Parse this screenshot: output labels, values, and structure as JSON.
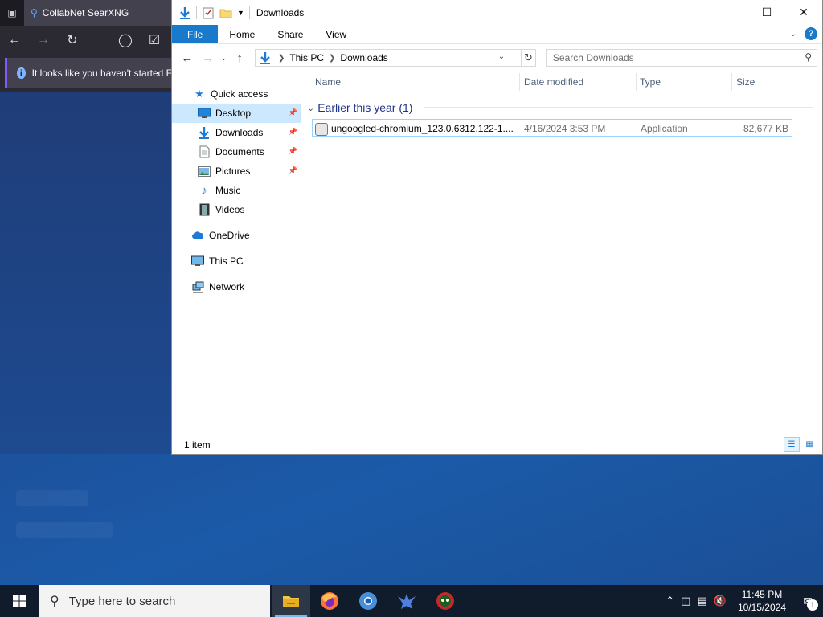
{
  "browser": {
    "tab_title": "CollabNet SearXNG",
    "banner_text": "It looks like you haven't started F"
  },
  "window": {
    "title": "Downloads",
    "ribbon_tabs": [
      "File",
      "Home",
      "Share",
      "View"
    ],
    "help": "?"
  },
  "address": {
    "crumbs": [
      "This PC",
      "Downloads"
    ],
    "search_placeholder": "Search Downloads"
  },
  "nav": {
    "quick_access": "Quick access",
    "items": [
      {
        "label": "Desktop",
        "pinned": true
      },
      {
        "label": "Downloads",
        "pinned": true
      },
      {
        "label": "Documents",
        "pinned": true
      },
      {
        "label": "Pictures",
        "pinned": true
      },
      {
        "label": "Music",
        "pinned": false
      },
      {
        "label": "Videos",
        "pinned": false
      }
    ],
    "onedrive": "OneDrive",
    "this_pc": "This PC",
    "network": "Network"
  },
  "columns": {
    "name": "Name",
    "date": "Date modified",
    "type": "Type",
    "size": "Size"
  },
  "group": {
    "label": "Earlier this year (1)"
  },
  "files": [
    {
      "name": "ungoogled-chromium_123.0.6312.122-1....",
      "date": "4/16/2024 3:53 PM",
      "type": "Application",
      "size": "82,677 KB"
    }
  ],
  "status": {
    "count": "1 item"
  },
  "taskbar": {
    "search_placeholder": "Type here to search",
    "time": "11:45 PM",
    "date": "10/15/2024",
    "notification_count": "1"
  }
}
